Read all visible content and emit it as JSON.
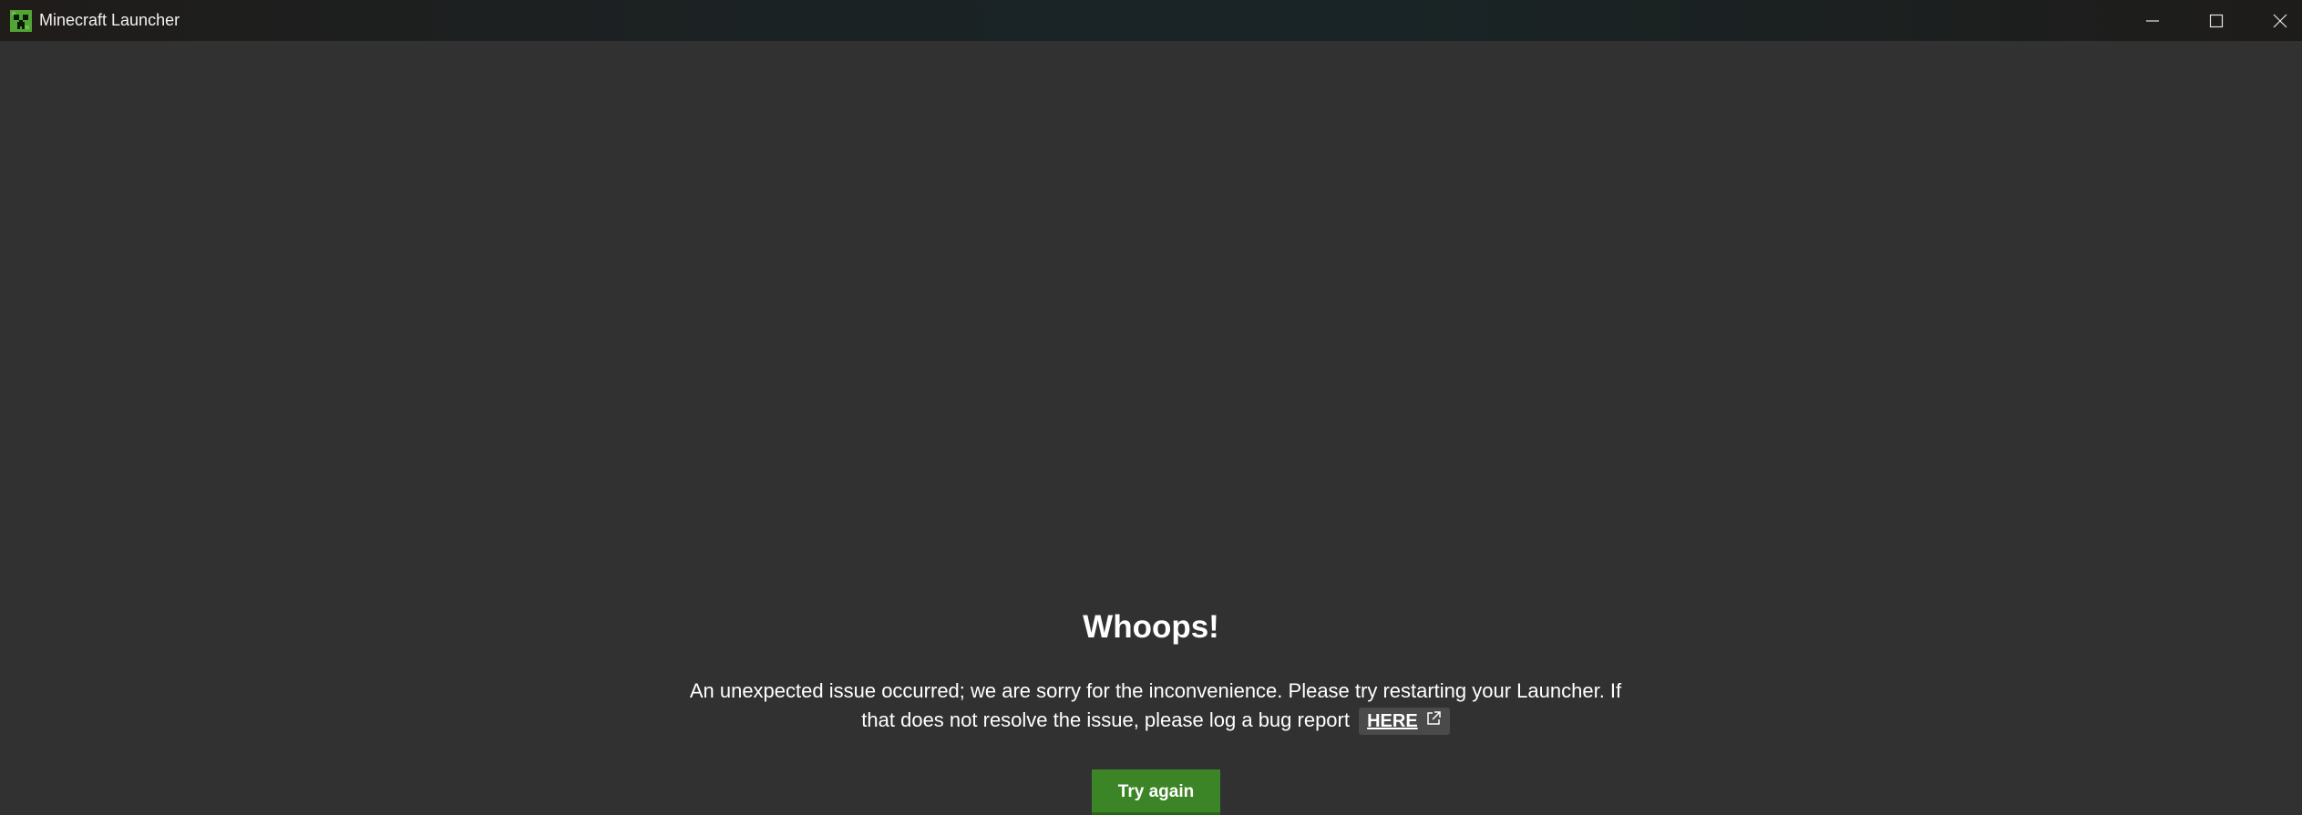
{
  "window": {
    "title": "Minecraft Launcher",
    "icon": "creeper-icon",
    "controls": {
      "minimize": "minimize-icon",
      "maximize": "maximize-icon",
      "close": "close-icon"
    }
  },
  "error": {
    "heading": "Whoops!",
    "message": "An unexpected issue occurred; we are sorry for the inconvenience. Please try restarting your Launcher. If that does not resolve the issue, please log a bug report",
    "link_label": "HERE",
    "link_icon": "external-link-icon",
    "retry_label": "Try again"
  },
  "colors": {
    "background": "#313131",
    "accent_green": "#3c8527",
    "link_bg": "#4a4a4a"
  }
}
